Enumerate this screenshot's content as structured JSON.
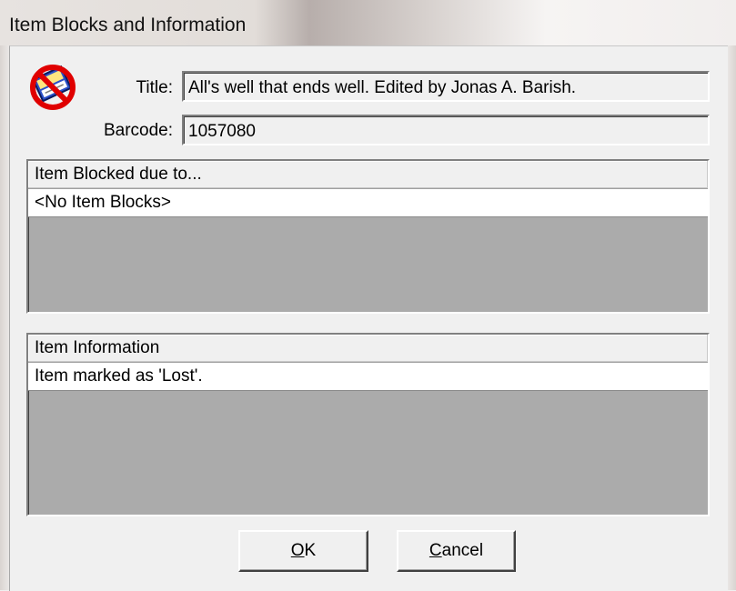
{
  "window": {
    "title": "Item Blocks and Information"
  },
  "icon": {
    "name": "blocked-book-icon"
  },
  "fields": {
    "title_label": "Title:",
    "title_value": "All's well that ends well. Edited by Jonas A. Barish.",
    "barcode_label": "Barcode:",
    "barcode_value": "1057080"
  },
  "blocks_list": {
    "header": "Item Blocked due to...",
    "rows": [
      "<No Item Blocks>"
    ]
  },
  "info_list": {
    "header": "Item Information",
    "rows": [
      "Item marked as 'Lost'."
    ]
  },
  "buttons": {
    "ok": {
      "mnemonic": "O",
      "rest": "K"
    },
    "cancel": {
      "mnemonic": "C",
      "rest": "ancel"
    }
  }
}
